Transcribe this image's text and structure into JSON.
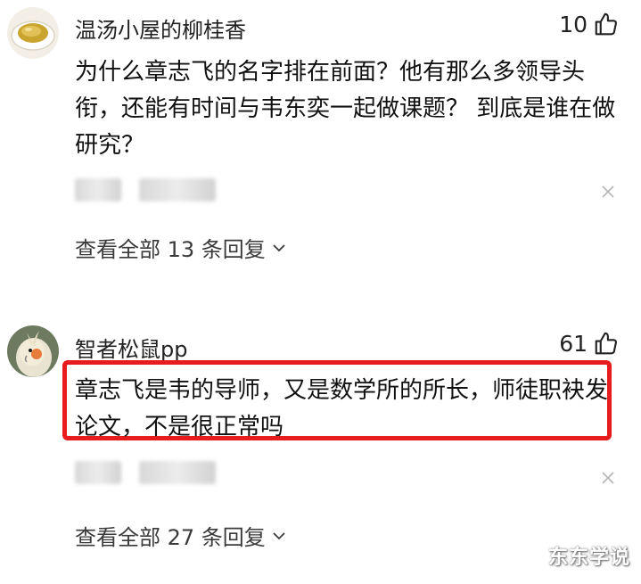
{
  "comments": [
    {
      "username": "温汤小屋的柳桂香",
      "avatar": "teacup-avatar",
      "likes": "10",
      "text": "为什么章志飞的名字排在前面？他有那么多领导头衔，还能有时间与韦东奕一起做课题？ 到底是谁在做研究？",
      "view_replies": "查看全部 13 条回复"
    },
    {
      "username": "智者松鼠pp",
      "avatar": "cockatiel-avatar",
      "likes": "61",
      "text": "章志飞是韦的导师，又是数学所的所长，师徒职袂发论文，不是很正常吗",
      "highlighted": true,
      "view_replies": "查看全部 27 条回复"
    }
  ],
  "icons": {
    "like": "thumbs-up-icon",
    "close": "close-icon",
    "expand": "chevron-down-icon"
  },
  "colors": {
    "highlight_border": "#e81c1c",
    "text": "#111111",
    "secondary_text": "#3a3a3a"
  },
  "watermark": "东东学说"
}
